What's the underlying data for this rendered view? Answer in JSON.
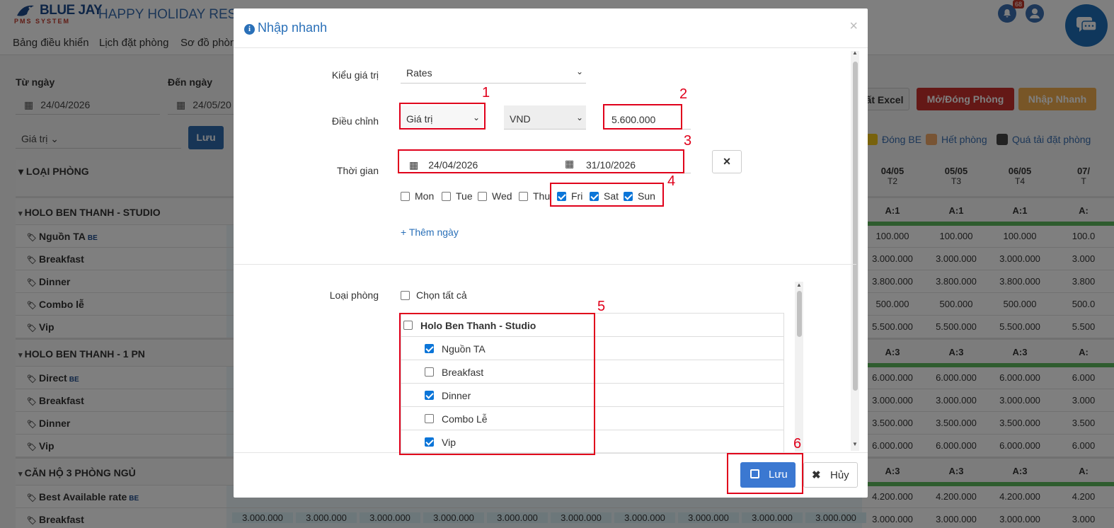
{
  "app": {
    "logo": "BLUE JAY",
    "logo_sub": "PMS SYSTEM",
    "resort": "HAPPY HOLIDAY RESO",
    "nav": [
      "Bảng điều khiển",
      "Lịch đặt phòng",
      "Sơ đồ phòn"
    ],
    "notif_count": "68"
  },
  "filters": {
    "from_label": "Từ ngày",
    "from_value": "24/04/2026",
    "to_label": "Đến ngày",
    "to_value": "24/05/20",
    "value_type": "Giá trị",
    "save_label": "Lưu"
  },
  "actions": {
    "excel": "ất Excel",
    "open_close": "Mở/Đóng Phòng",
    "quick_entry": "Nhập Nhanh"
  },
  "legend": [
    "Đóng BE",
    "Hết phòng",
    "Quá tải đặt phòng"
  ],
  "grid": {
    "header_label": "LOẠI PHÒNG",
    "dates": [
      {
        "d": "04/05",
        "w": "T2"
      },
      {
        "d": "05/05",
        "w": "T3"
      },
      {
        "d": "06/05",
        "w": "T4"
      },
      {
        "d": "07/",
        "w": "T"
      }
    ],
    "rows": [
      {
        "kind": "group",
        "label": "HOLO BEN THANH - STUDIO",
        "vals": [
          "A:1",
          "A:1",
          "A:1",
          "A:"
        ]
      },
      {
        "kind": "item",
        "label": "Nguồn TA",
        "be": "BE",
        "vals": [
          "100.000",
          "100.000",
          "100.000",
          "100.0"
        ]
      },
      {
        "kind": "item",
        "label": "Breakfast",
        "vals": [
          "3.000.000",
          "3.000.000",
          "3.000.000",
          "3.000"
        ]
      },
      {
        "kind": "item",
        "label": "Dinner",
        "vals": [
          "3.800.000",
          "3.800.000",
          "3.800.000",
          "3.800"
        ]
      },
      {
        "kind": "item",
        "label": "Combo lễ",
        "vals": [
          "500.000",
          "500.000",
          "500.000",
          "500.0"
        ]
      },
      {
        "kind": "item",
        "label": "Vip",
        "vals": [
          "5.500.000",
          "5.500.000",
          "5.500.000",
          "5.500"
        ]
      },
      {
        "kind": "group",
        "label": "HOLO BEN THANH - 1 PN",
        "vals": [
          "A:3",
          "A:3",
          "A:3",
          "A:"
        ]
      },
      {
        "kind": "item",
        "label": "Direct",
        "be": "BE",
        "vals": [
          "6.000.000",
          "6.000.000",
          "6.000.000",
          "6.000"
        ]
      },
      {
        "kind": "item",
        "label": "Breakfast",
        "vals": [
          "3.000.000",
          "3.000.000",
          "3.000.000",
          "3.000"
        ]
      },
      {
        "kind": "item",
        "label": "Dinner",
        "vals": [
          "3.500.000",
          "3.500.000",
          "3.500.000",
          "3.500"
        ]
      },
      {
        "kind": "item",
        "label": "Vip",
        "vals": [
          "6.000.000",
          "6.000.000",
          "6.000.000",
          "6.000"
        ]
      },
      {
        "kind": "group",
        "label": "CĂN HỘ 3 PHÒNG NGỦ",
        "vals": [
          "A:3",
          "A:3",
          "A:3",
          "A:"
        ]
      },
      {
        "kind": "item",
        "label": "Best Available rate",
        "be": "BE",
        "vals": [
          "4.200.000",
          "4.200.000",
          "4.200.000",
          "4.200"
        ]
      },
      {
        "kind": "item",
        "label": "Breakfast",
        "vals": [
          "3.000.000",
          "3.000.000",
          "3.000.000",
          "3.000"
        ]
      }
    ],
    "bottom_row_values": [
      "3.000.000",
      "3.000.000",
      "3.000.000",
      "3.000.000",
      "3.000.000",
      "3.000.000",
      "3.000.000",
      "3.000.000",
      "3.000.000",
      "3.000.000",
      "3.000.000"
    ]
  },
  "modal": {
    "title": "Nhập nhanh",
    "close": "×",
    "value_kind_label": "Kiểu giá trị",
    "value_kind": "Rates",
    "adjust_label": "Điều chỉnh",
    "adjust_type": "Giá trị",
    "currency": "VND",
    "amount": "5.600.000",
    "time_label": "Thời gian",
    "date_from": "24/04/2026",
    "date_to": "31/10/2026",
    "clear": "×",
    "days": [
      {
        "label": "Mon",
        "checked": false
      },
      {
        "label": "Tue",
        "checked": false
      },
      {
        "label": "Wed",
        "checked": false
      },
      {
        "label": "Thu",
        "checked": false
      },
      {
        "label": "Fri",
        "checked": true
      },
      {
        "label": "Sat",
        "checked": true
      },
      {
        "label": "Sun",
        "checked": true
      }
    ],
    "add_day": "+ Thêm ngày",
    "room_type_label": "Loại phòng",
    "select_all": "Chọn tất cả",
    "room_group": "Holo Ben Thanh - Studio",
    "rates": [
      {
        "label": "Nguồn TA",
        "checked": true
      },
      {
        "label": "Breakfast",
        "checked": false
      },
      {
        "label": "Dinner",
        "checked": true
      },
      {
        "label": "Combo Lễ",
        "checked": false
      },
      {
        "label": "Vip",
        "checked": true
      }
    ],
    "save": "Lưu",
    "cancel": "Hủy",
    "markers": [
      "1",
      "2",
      "3",
      "4",
      "5",
      "6"
    ]
  },
  "colors": {
    "primary": "#3b78d1",
    "annotation": "#e0001b",
    "open_close_btn": "#c9302c",
    "quick_btn": "#f0ad4e",
    "legend_closed_be": "#f0c419",
    "legend_full": "#f0a868",
    "legend_overbook": "#333333"
  }
}
